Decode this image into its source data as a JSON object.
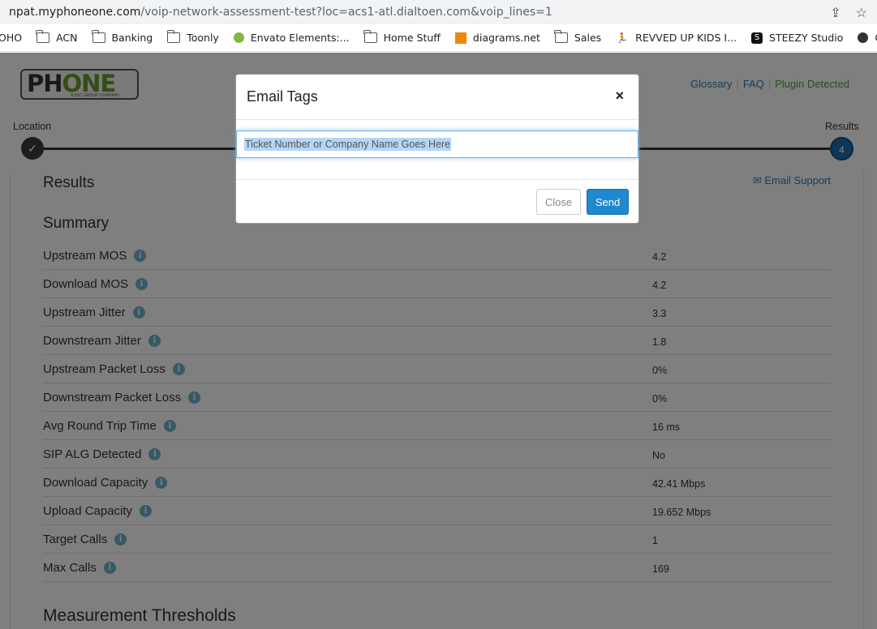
{
  "browser": {
    "url_host": "npat.myphoneone.com",
    "url_path": "/voip-network-assessment-test?loc=acs1-atl.dialtoen.com&voip_lines=1",
    "bookmarks": [
      {
        "label": "OHO",
        "icon": "none"
      },
      {
        "label": "ACN",
        "icon": "folder-icon"
      },
      {
        "label": "Banking",
        "icon": "folder-icon"
      },
      {
        "label": "Toonly",
        "icon": "folder-icon"
      },
      {
        "label": "Envato Elements:...",
        "icon": "envato-icon"
      },
      {
        "label": "Home Stuff",
        "icon": "folder-icon"
      },
      {
        "label": "diagrams.net",
        "icon": "diagrams-icon"
      },
      {
        "label": "Sales",
        "icon": "folder-icon"
      },
      {
        "label": "REVVED UP KIDS I...",
        "icon": "runner-icon"
      },
      {
        "label": "STEEZY Studio",
        "icon": "steezy-icon"
      },
      {
        "label": "CharityNet U",
        "icon": "globe-icon"
      }
    ]
  },
  "header": {
    "logo_ph": "PH",
    "logo_one": "ONE",
    "logo_sub": "A BSC GROUP COMPANY",
    "nav": {
      "glossary": "Glossary",
      "faq": "FAQ",
      "plugin": "Plugin Detected"
    }
  },
  "stepper": {
    "first_label": "Location",
    "last_label": "Results",
    "first_mark": "✓",
    "current_step": "4"
  },
  "results": {
    "title": "Results",
    "email_support": "Email Support",
    "summary_title": "Summary",
    "rows": [
      {
        "label": "Upstream MOS",
        "value": "4.2"
      },
      {
        "label": "Download MOS",
        "value": "4.2"
      },
      {
        "label": "Upstream Jitter",
        "value": "3.3"
      },
      {
        "label": "Downstream Jitter",
        "value": "1.8"
      },
      {
        "label": "Upstream Packet Loss",
        "value": "0%"
      },
      {
        "label": "Downstream Packet Loss",
        "value": "0%"
      },
      {
        "label": "Avg Round Trip Time",
        "value": "16 ms"
      },
      {
        "label": "SIP ALG Detected",
        "value": "No"
      },
      {
        "label": "Download Capacity",
        "value": "42.41 Mbps"
      },
      {
        "label": "Upload Capacity",
        "value": "19.652 Mbps"
      },
      {
        "label": "Target Calls",
        "value": "1"
      },
      {
        "label": "Max Calls",
        "value": "169"
      }
    ],
    "thresholds_title": "Measurement Thresholds"
  },
  "modal": {
    "title": "Email Tags",
    "close_x": "×",
    "input_value": "Ticket Number or Company Name Goes Here",
    "close_label": "Close",
    "send_label": "Send"
  },
  "colors": {
    "accent": "#1e88d0",
    "link": "#2a7ab8",
    "plugin": "#4aa03c",
    "logo_green": "#6a9a2a"
  }
}
